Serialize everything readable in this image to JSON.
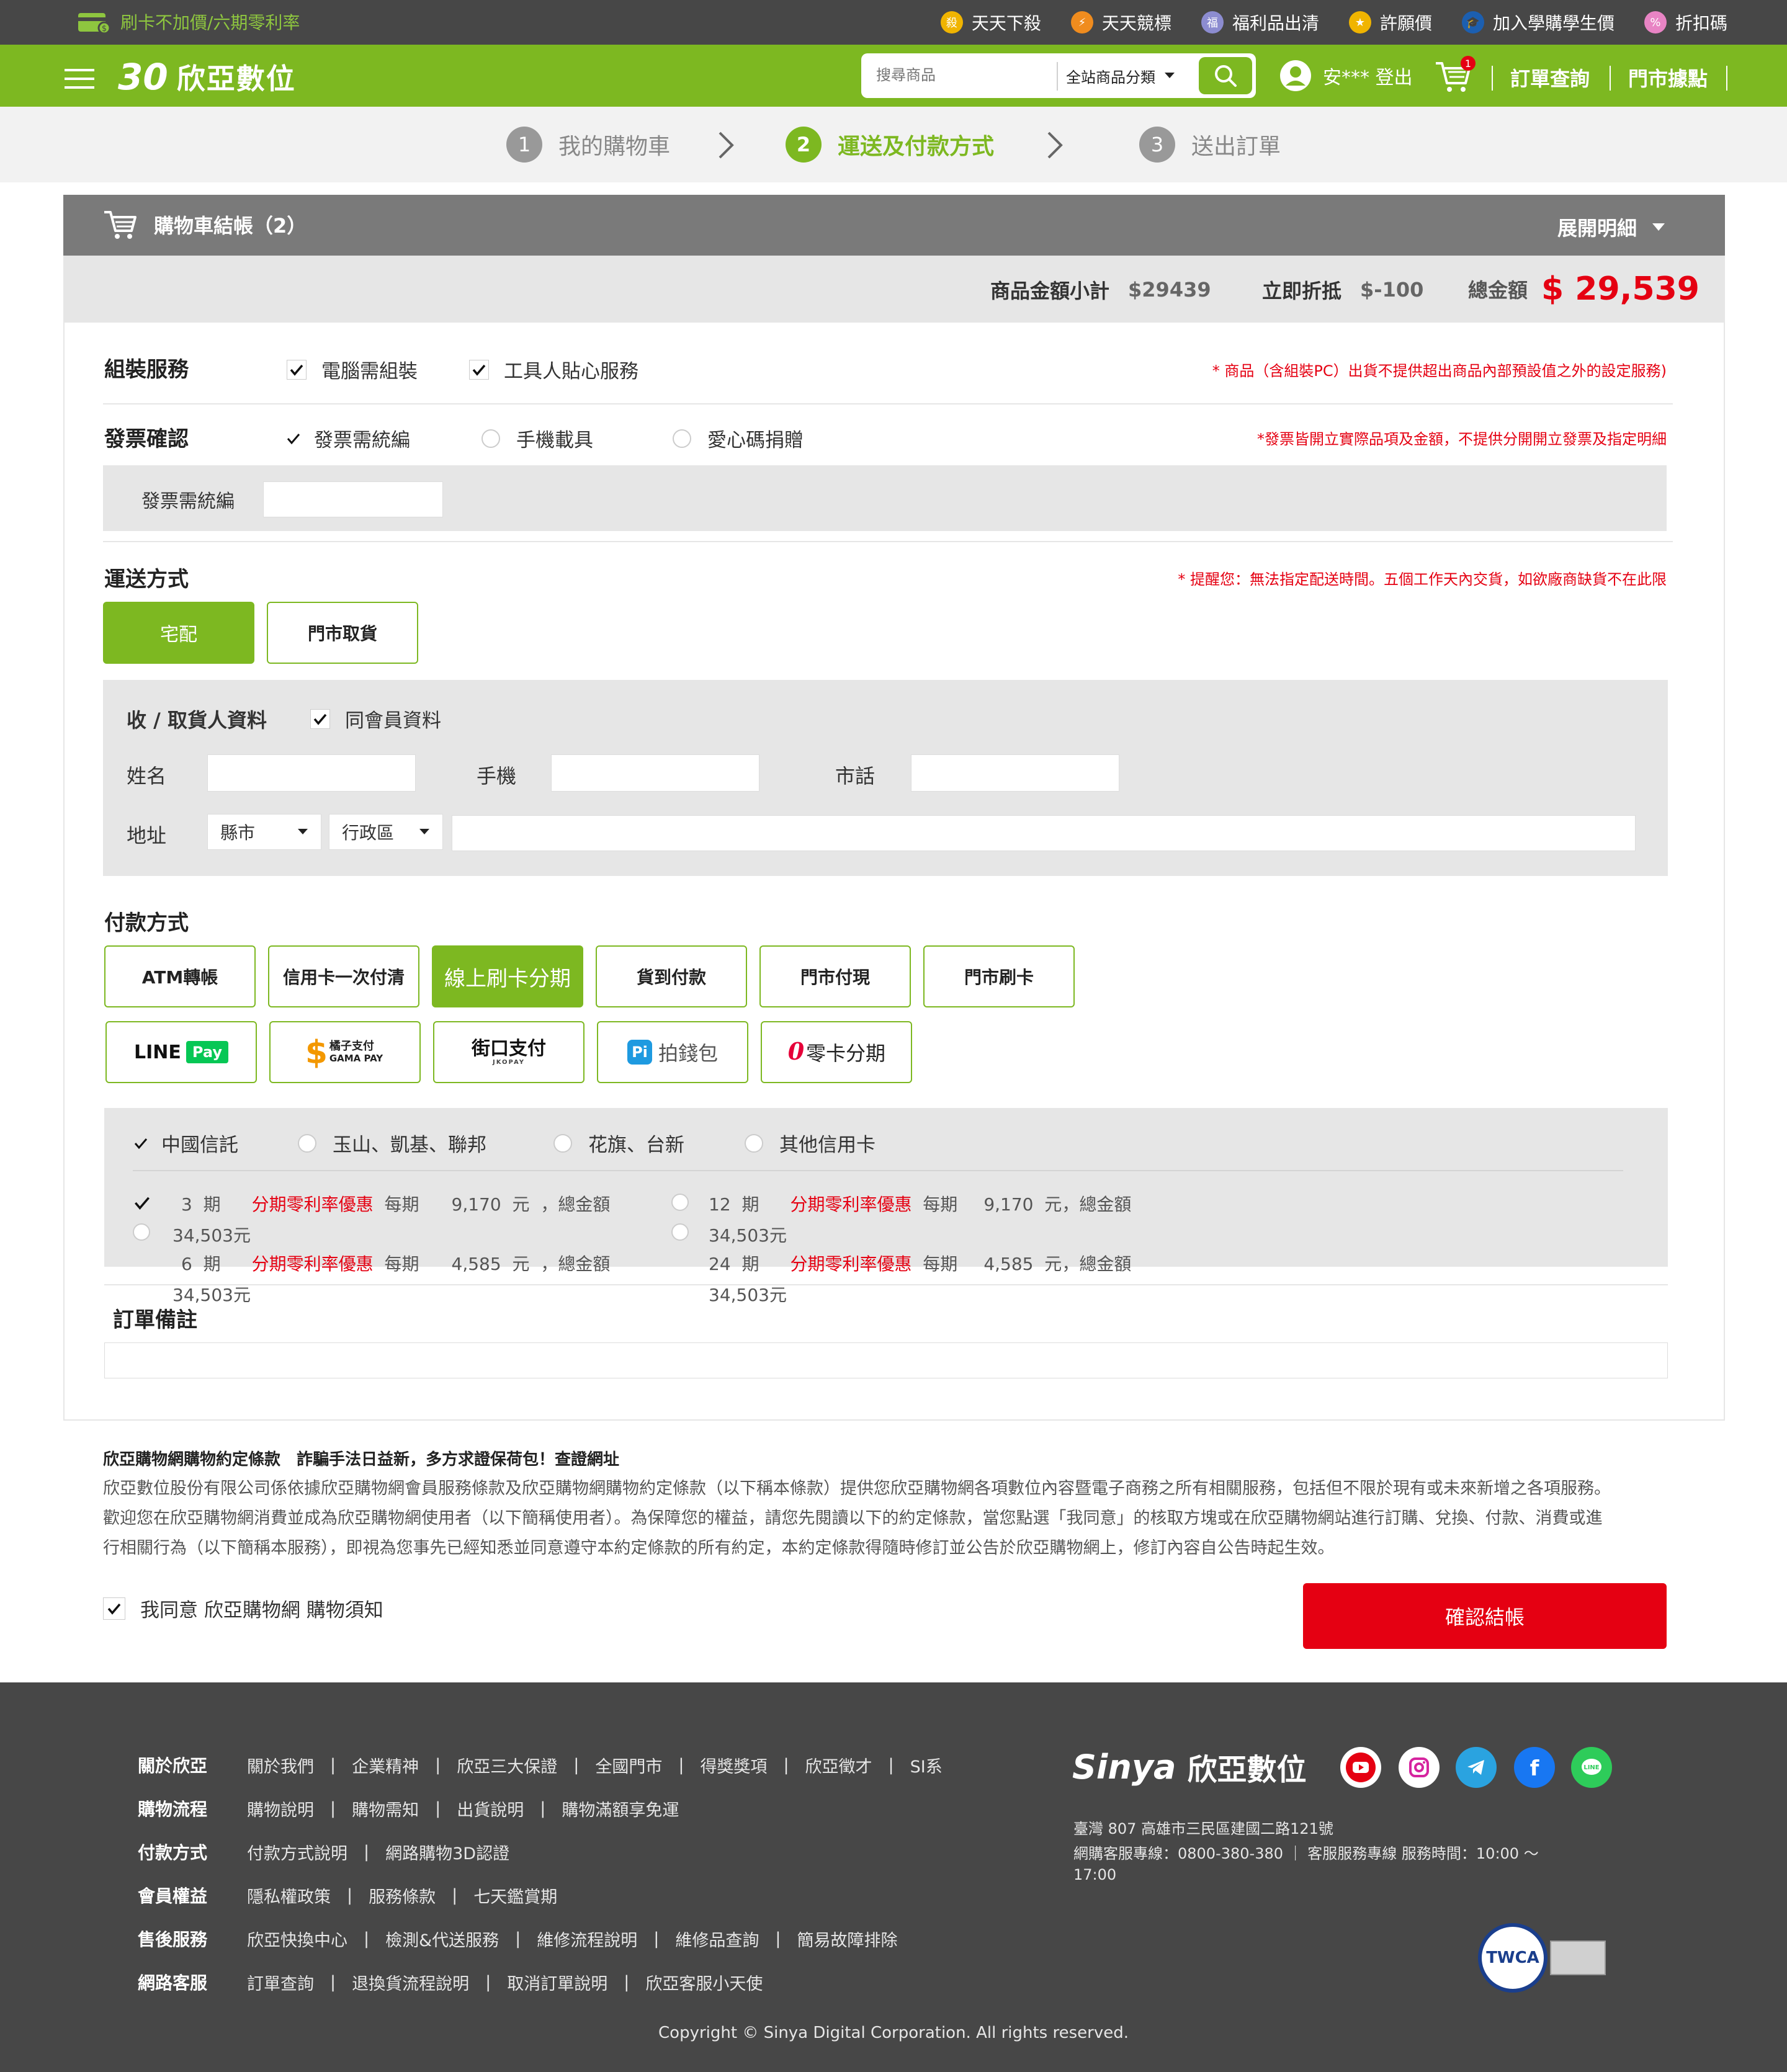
{
  "topbar": {
    "promo": "刷卡不加價/六期零利率",
    "links": [
      {
        "label": "天天下殺",
        "badge": "殺",
        "color": "#f0b400"
      },
      {
        "label": "天天競標",
        "badge": "⚡",
        "color": "#f08c1e"
      },
      {
        "label": "福利品出清",
        "badge": "福",
        "color": "#8c8cd0"
      },
      {
        "label": "許願價",
        "badge": "★",
        "color": "#f0b400"
      },
      {
        "label": "加入學購學生價",
        "badge": "🎓",
        "color": "#1c5fb0"
      },
      {
        "label": "折扣碼",
        "badge": "%",
        "color": "#e884c4"
      }
    ]
  },
  "header": {
    "logo_30": "30",
    "brand": "欣亞數位",
    "search_placeholder": "搜尋商品",
    "category": "全站商品分類",
    "user": "安*** 登出",
    "cart_count": "1",
    "orders": "訂單查詢",
    "stores": "門市據點"
  },
  "steps": [
    {
      "num": "1",
      "label": "我的購物車"
    },
    {
      "num": "2",
      "label": "運送及付款方式"
    },
    {
      "num": "3",
      "label": "送出訂單"
    }
  ],
  "cart": {
    "title": "購物車結帳（2）",
    "expand": "展開明細",
    "subtotal_label": "商品金額小計",
    "subtotal": "$29439",
    "discount_label": "立即折抵",
    "discount": "$-100",
    "total_label": "總金額",
    "total": "$ 29,539"
  },
  "assembly": {
    "title": "組裝服務",
    "opt1": "電腦需組裝",
    "opt2": "工具人貼心服務",
    "note": "* 商品（含組裝PC）出貨不提供超出商品內部預設值之外的設定服務)"
  },
  "invoice": {
    "title": "發票確認",
    "opt1": "發票需統編",
    "opt2": "手機載具",
    "opt3": "愛心碼捐贈",
    "note": "*發票皆開立實際品項及金額，不提供分開開立發票及指定明細",
    "taxid_label": "發票需統編"
  },
  "shipping": {
    "title": "運送方式",
    "note": "* 提醒您：無法指定配送時間。五個工作天內交貨，如欲廠商缺貨不在此限",
    "home": "宅配",
    "store": "門市取貨",
    "recipient_title": "收 / 取貨人資料",
    "same_member": "同會員資料",
    "name": "姓名",
    "mobile": "手機",
    "phone": "市話",
    "address": "地址",
    "city": "縣市",
    "district": "行政區"
  },
  "payment": {
    "title": "付款方式",
    "methods": [
      "ATM轉帳",
      "信用卡一次付清",
      "線上刷卡分期",
      "貨到付款",
      "門市付現",
      "門市刷卡"
    ],
    "wallets": {
      "line": "LINE",
      "linepay": "Pay",
      "gama1": "橘子支付",
      "gama2": "GAMA PAY",
      "jko1": "街口支付",
      "jko2": "JKOPAY",
      "pi": "拍錢包",
      "zero": "零卡分期"
    },
    "banks": [
      "中國信託",
      "玉山、凱基、聯邦",
      "花旗、台新",
      "其他信用卡"
    ],
    "promo": "分期零利率優惠",
    "installments": [
      {
        "period": "3",
        "unit": "期",
        "each_label": "每期",
        "each": "9,170",
        "yuan": "元",
        "total_label": "，總金額",
        "total": "34,503元"
      },
      {
        "period": "6",
        "unit": "期",
        "each_label": "每期",
        "each": "4,585",
        "yuan": "元",
        "total_label": "，總金額",
        "total": "34,503元"
      },
      {
        "period": "12",
        "unit": "期",
        "each_label": "每期",
        "each": "9,170",
        "yuan": "元",
        "total_label": "，總金額",
        "total": "34,503元"
      },
      {
        "period": "24",
        "unit": "期",
        "each_label": "每期",
        "each": "4,585",
        "yuan": "元",
        "total_label": "，總金額",
        "total": "34,503元"
      }
    ]
  },
  "remarks": {
    "title": "訂單備註"
  },
  "terms": {
    "heading": "欣亞購物網購物約定條款　詐騙手法日益新，多方求證保荷包！查證網址",
    "line1": "欣亞數位股份有限公司係依據欣亞購物網會員服務條款及欣亞購物網購物約定條款（以下稱本條款）提供您欣亞購物網各項數位內容暨電子商務之所有相關服務，包括但不限於現有或未來新增之各項服務。",
    "line2": "歡迎您在欣亞購物網消費並成為欣亞購物網使用者（以下簡稱使用者）。為保障您的權益，請您先閱讀以下的約定條款，當您點選「我同意」的核取方塊或在欣亞購物網站進行訂購、兌換、付款、消費或進",
    "line3": "行相關行為（以下簡稱本服務），即視為您事先已經知悉並同意遵守本約定條款的所有約定，本約定條款得隨時修訂並公告於欣亞購物網上，修訂內容自公告時起生效。",
    "agree": "我同意 欣亞購物網 購物須知",
    "confirm": "確認結帳"
  },
  "footer": {
    "rows": [
      {
        "h": "關於欣亞",
        "items": [
          "關於我們",
          "企業精神",
          "欣亞三大保證",
          "全國門市",
          "得獎獎項",
          "欣亞徵才",
          "SI系"
        ]
      },
      {
        "h": "購物流程",
        "items": [
          "購物說明",
          "購物需知",
          "出貨說明",
          "購物滿額享免運"
        ]
      },
      {
        "h": "付款方式",
        "items": [
          "付款方式說明",
          "網路購物3D認證"
        ]
      },
      {
        "h": "會員權益",
        "items": [
          "隱私權政策",
          "服務條款",
          "七天鑑賞期"
        ]
      },
      {
        "h": "售後服務",
        "items": [
          "欣亞快換中心",
          "檢測&代送服務",
          "維修流程說明",
          "維修品查詢",
          "簡易故障排除"
        ]
      },
      {
        "h": "網路客服",
        "items": [
          "訂單查詢",
          "退換貨流程說明",
          "取消訂單說明",
          "欣亞客服小天使"
        ]
      }
    ],
    "logo_en": "Sinya",
    "logo_zh": "欣亞數位",
    "address": "臺灣  807  高雄市三民區建國二路121號",
    "service1": "網購客服專線：0800-380-380  ｜  客服服務專線  服務時間：10:00 ～",
    "service2": "17:00",
    "badge": "TWCA",
    "copyright": "Copyright © Sinya Digital Corporation. All rights reserved."
  }
}
